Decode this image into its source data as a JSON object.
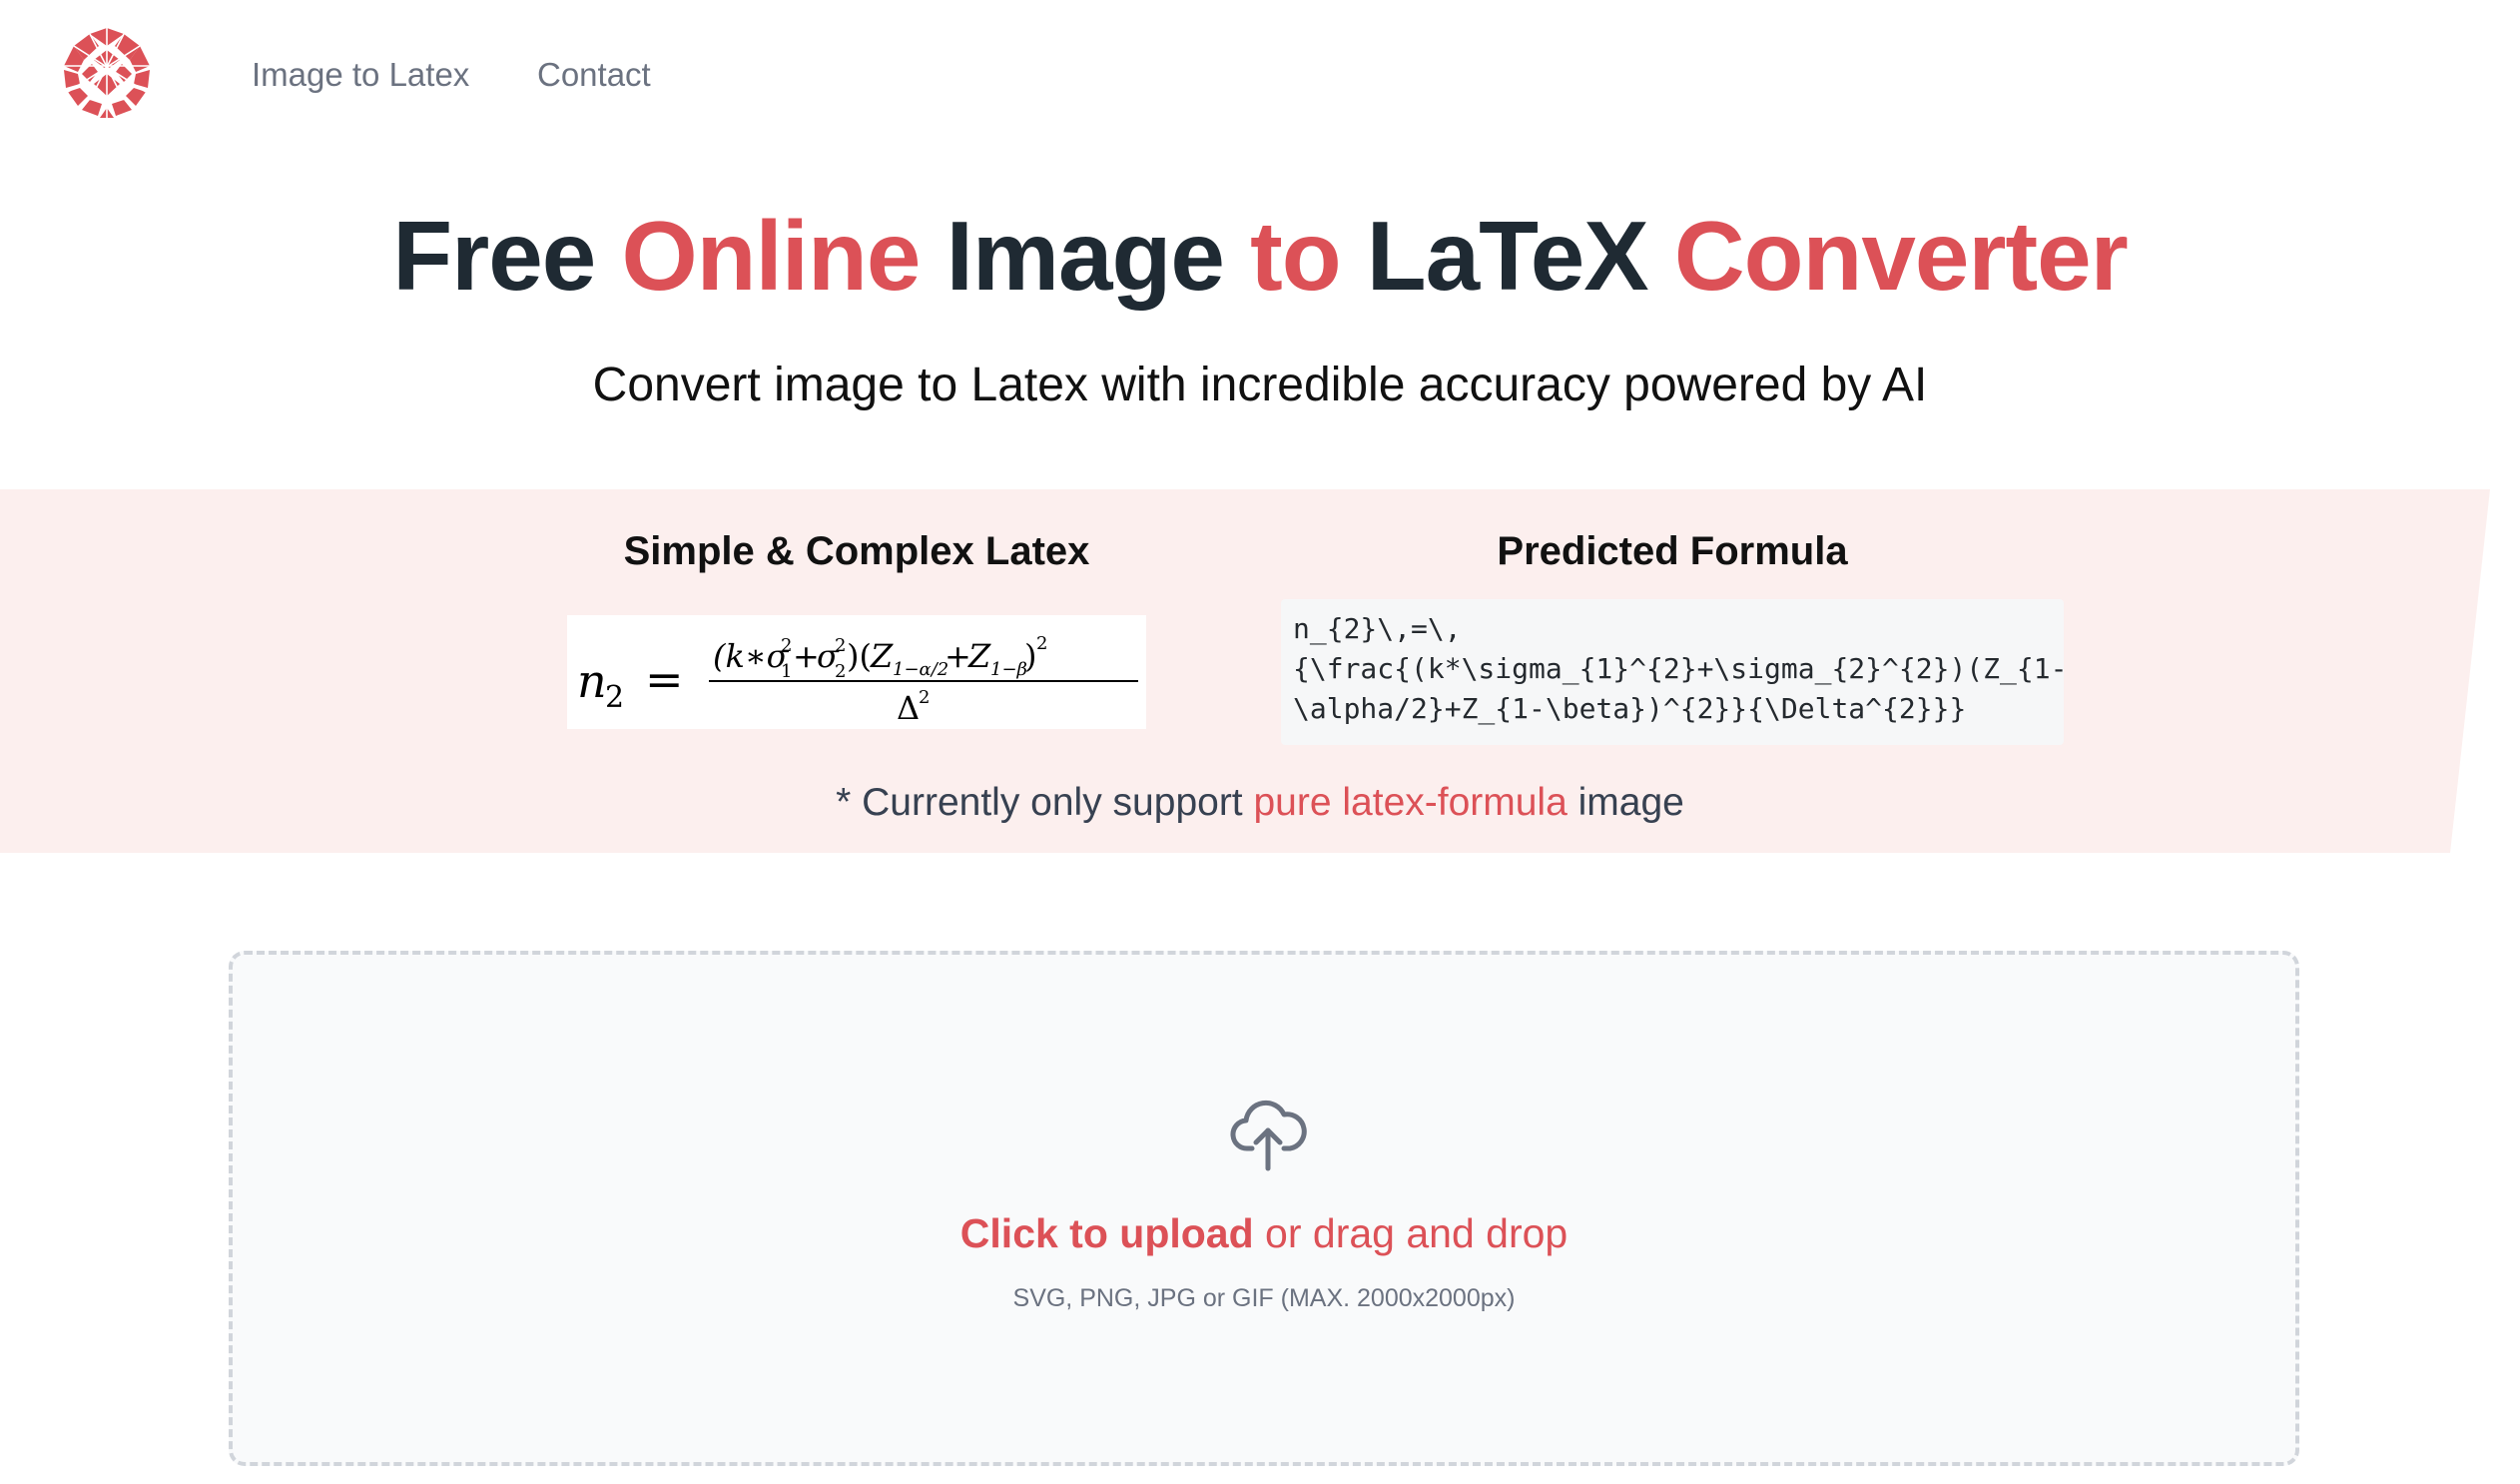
{
  "nav": {
    "links": [
      {
        "label": "Image to Latex"
      },
      {
        "label": "Contact"
      }
    ]
  },
  "logo": {
    "icon": "geodesic-sphere-logo-icon"
  },
  "hero": {
    "title_parts": [
      "Free ",
      "Online",
      " Image ",
      "to",
      " LaTeX ",
      "Converter"
    ],
    "subtitle": "Convert image to Latex with incredible accuracy powered by AI"
  },
  "example": {
    "left_heading": "Simple & Complex Latex",
    "right_heading": "Predicted Formula",
    "code_lines": [
      "n_{2}\\,=\\,",
      "{\\frac{(k*\\sigma_{1}^{2}+\\sigma_{2}^{2})(Z_{1-",
      "\\alpha/2}+Z_{1-\\beta})^{2}}{\\Delta^{2}}}"
    ],
    "note_prefix": "* Currently only support ",
    "note_highlight": "pure latex-formula",
    "note_suffix": " image"
  },
  "upload": {
    "icon": "cloud-upload-icon",
    "click_label": "Click to upload",
    "drag_label": " or drag and drop",
    "hint": "SVG, PNG, JPG or GIF (MAX. 2000x2000px)"
  },
  "colors": {
    "accent": "#dc5157",
    "band": "#fcefee",
    "title": "#1f2a33",
    "nav": "#6b7280"
  }
}
